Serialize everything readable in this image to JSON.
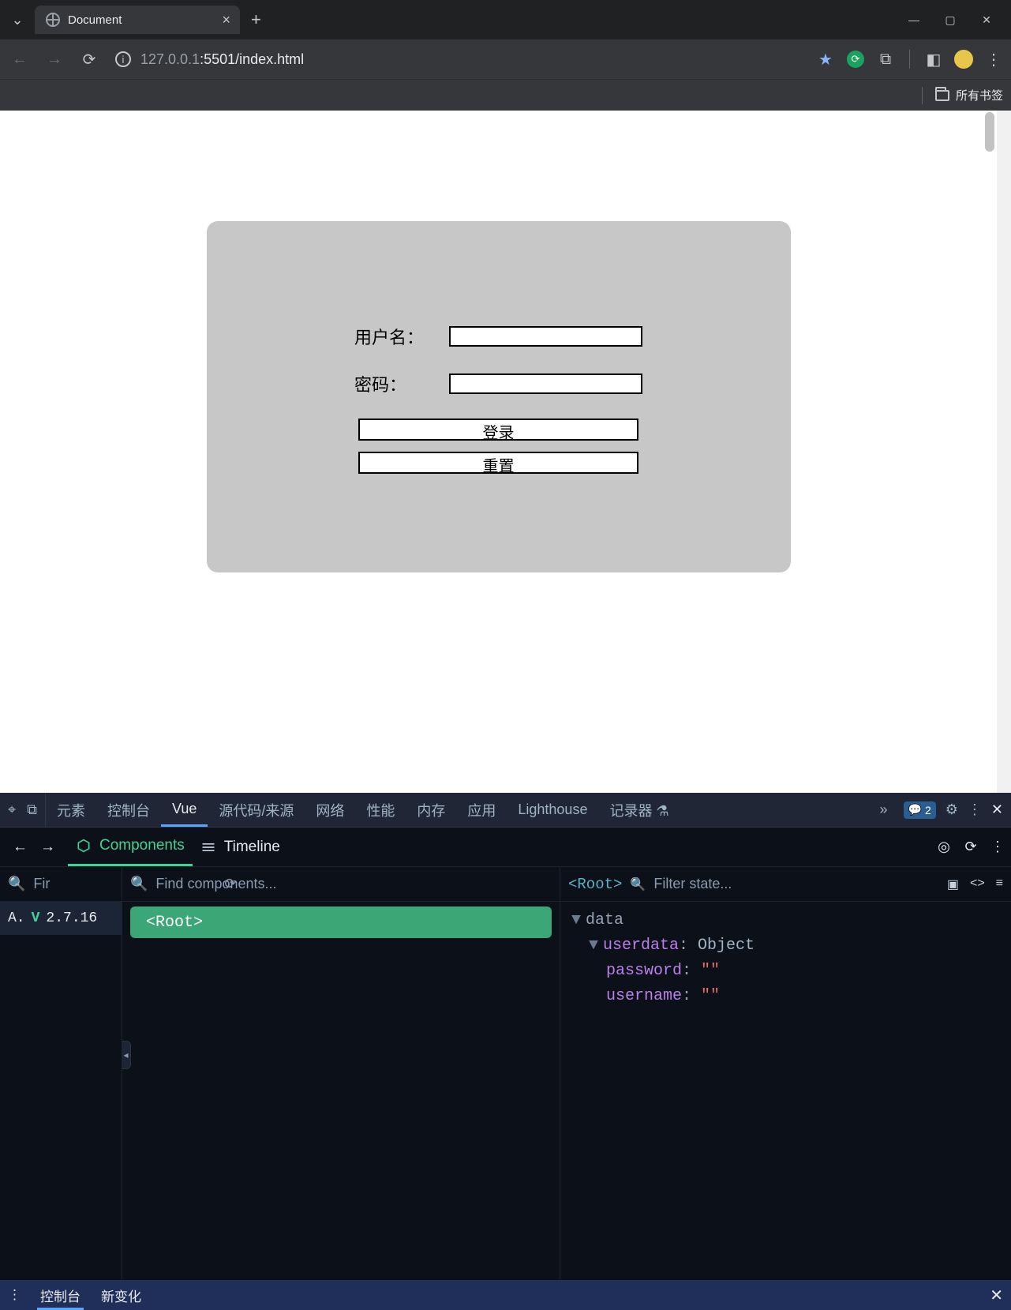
{
  "browser": {
    "tab_title": "Document",
    "url_dim": "127.0.0.1",
    "url_rest": ":5501/index.html",
    "bookmarks_label": "所有书签"
  },
  "login": {
    "username_label": "用户名：",
    "password_label": "密码：",
    "login_btn": "登录",
    "reset_btn": "重置",
    "username_value": "",
    "password_value": ""
  },
  "devtools": {
    "tabs": [
      "元素",
      "控制台",
      "Vue",
      "源代码/来源",
      "网络",
      "性能",
      "内存",
      "应用",
      "Lighthouse",
      "记录器 ⚗"
    ],
    "active_tab": "Vue",
    "issue_count": "2"
  },
  "vuedev": {
    "nav_back": "←",
    "nav_fwd": "→",
    "sub_components": "Components",
    "sub_timeline": "Timeline",
    "filter_apps_placeholder": "Fir",
    "find_components_placeholder": "Find components...",
    "filter_state_placeholder": "Filter state...",
    "app_version": "2.7.16",
    "app_letter": "A.",
    "root_label": "<Root>",
    "selected_tag": "<Root>"
  },
  "state": {
    "top_key": "data",
    "obj_key": "userdata",
    "obj_type": "Object",
    "p_key": "password",
    "p_val": "\"\"",
    "u_key": "username",
    "u_val": "\"\""
  },
  "drawer": {
    "tabs": [
      "控制台",
      "新变化"
    ],
    "active": "控制台"
  }
}
